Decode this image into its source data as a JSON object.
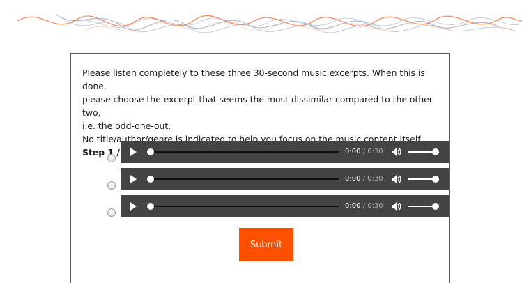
{
  "header": {
    "decoration": "sound-waves-logo"
  },
  "instructions": {
    "line1": "Please listen completely to these three 30-second music excerpts. When this is done,",
    "line2": "please choose the excerpt that seems the most dissimilar compared to the other two,",
    "line3": "i.e. the odd-one-out.",
    "line4": "No title/author/genre is indicated to help you focus on the music content itself.",
    "step": "Step 1 / 15:"
  },
  "excerpts": [
    {
      "current_time": "0:00",
      "duration": "/ 0:30",
      "progress": 0,
      "volume": 1.0,
      "selected": false
    },
    {
      "current_time": "0:00",
      "duration": "/ 0:30",
      "progress": 0,
      "volume": 1.0,
      "selected": false
    },
    {
      "current_time": "0:00",
      "duration": "/ 0:30",
      "progress": 0,
      "volume": 1.0,
      "selected": false
    }
  ],
  "icons": {
    "play": "play-icon",
    "volume": "volume-icon"
  },
  "submit": {
    "label": "Submit",
    "color": "#ff5000"
  },
  "colors": {
    "player_bg": "#444444",
    "wave_orange": "#ff6a33",
    "wave_blue": "#8fa4c4"
  }
}
